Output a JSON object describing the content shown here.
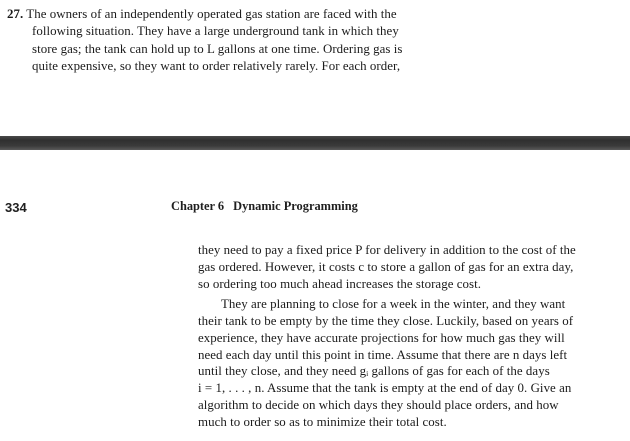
{
  "problem": {
    "number": "27.",
    "lines": [
      " The owners of an independently operated gas station are faced with the",
      "following situation. They have a large underground tank in which they",
      "store gas; the tank can hold up to L gallons at one time. Ordering gas is",
      "quite expensive, so they want to order relatively rarely. For each order,"
    ]
  },
  "page": {
    "number": "334",
    "chapter": "Chapter 6",
    "chapter_title": "Dynamic Programming"
  },
  "body": {
    "paragraph1": [
      "they need to pay a fixed price P for delivery in addition to the cost of the",
      "gas ordered. However, it costs c to store a gallon of gas for an extra day,",
      "so ordering too much ahead increases the storage cost."
    ],
    "paragraph2": [
      "They are planning to close for a week in the winter, and they want",
      "their tank to be empty by the time they close. Luckily, based on years of",
      "experience, they have accurate projections for how much gas they will",
      "need each day until this point in time. Assume that there are n days left",
      "until they close, and they need gᵢ gallons of gas for each of the days",
      "i = 1, . . . , n. Assume that the tank is empty at the end of day 0. Give an",
      "algorithm to decide on which days they should place orders, and how",
      "much to order so as to minimize their total cost."
    ]
  }
}
